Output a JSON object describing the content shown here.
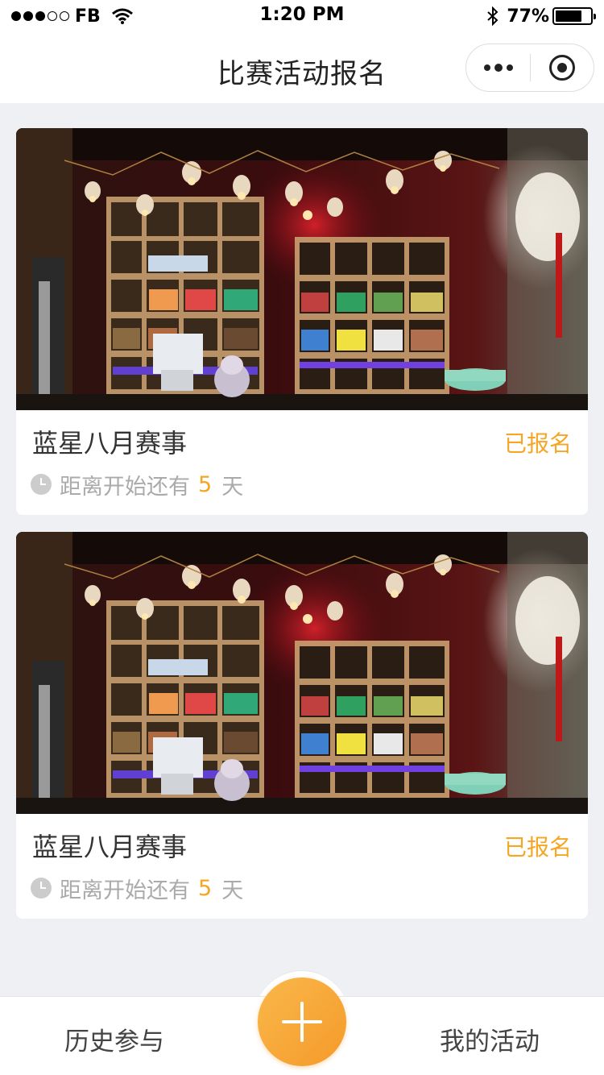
{
  "status_bar": {
    "carrier": "FB",
    "time": "1:20 PM",
    "battery_percent": "77%",
    "battery_level": 0.77,
    "signal_bars_filled": 3,
    "signal_bars_total": 5
  },
  "nav": {
    "title": "比赛活动报名",
    "more_icon": "more-dots-icon",
    "close_icon": "target-close-icon"
  },
  "events": [
    {
      "title": "蓝星八月赛事",
      "status": "已报名",
      "countdown_prefix": "距离开始还有",
      "countdown_days": "5",
      "countdown_suffix": "天",
      "image": "bar-shelf-photo"
    },
    {
      "title": "蓝星八月赛事",
      "status": "已报名",
      "countdown_prefix": "距离开始还有",
      "countdown_days": "5",
      "countdown_suffix": "天",
      "image": "bar-shelf-photo"
    }
  ],
  "tab_bar": {
    "left_label": "历史参与",
    "right_label": "我的活动",
    "center_icon": "plus-icon"
  },
  "colors": {
    "accent": "#f5a623",
    "background": "#eef0f4",
    "card": "#ffffff",
    "muted_text": "#aaaaaa"
  }
}
